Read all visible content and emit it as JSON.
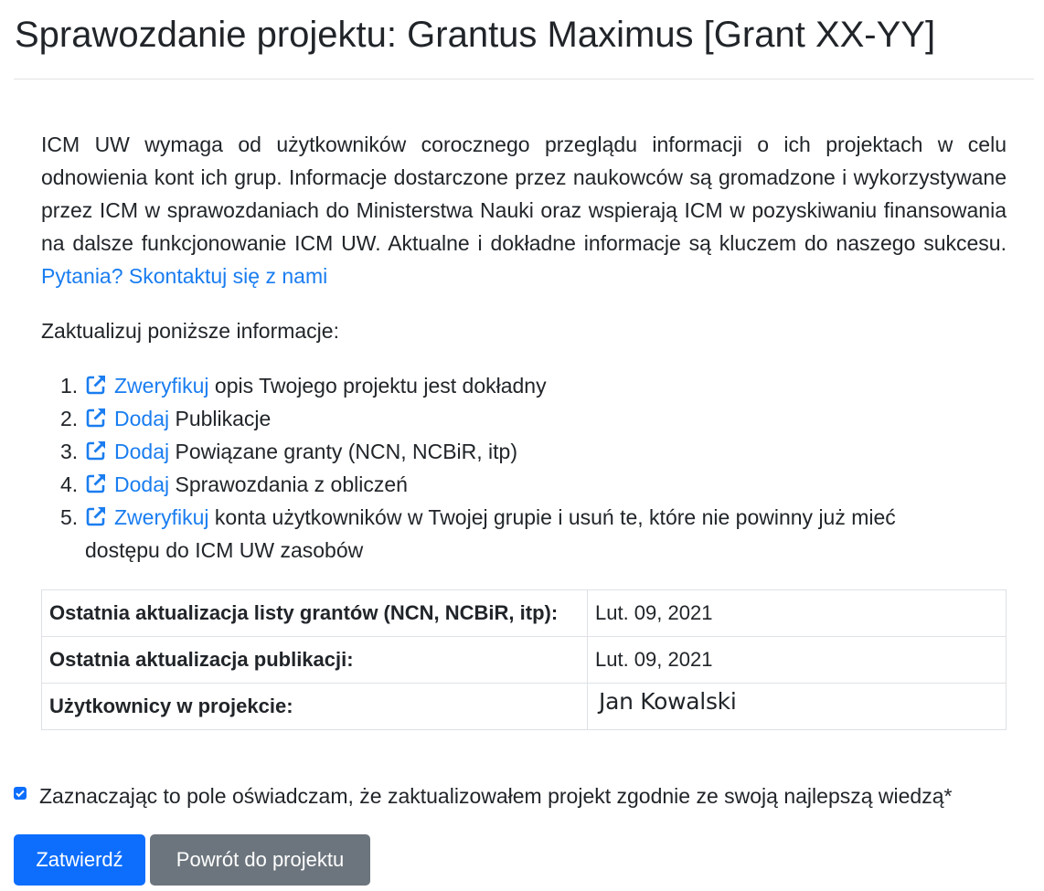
{
  "page": {
    "title": "Sprawozdanie projektu: Grantus Maximus [Grant XX-YY]"
  },
  "intro": {
    "text": "ICM UW wymaga od użytkowników corocznego przeglądu informacji o ich projektach w celu odnowienia kont ich grup. Informacje dostarczone przez naukowców są gromadzone i wykorzystywane przez ICM w sprawozdaniach do Ministerstwa Nauki oraz wspierają ICM w pozyskiwaniu finansowania na dalsze funkcjonowanie ICM UW. Aktualne i dokładne informacje są kluczem do naszego sukcesu.",
    "contact_link": "Pytania? Skontaktuj się z nami"
  },
  "update_heading": "Zaktualizuj poniższe informacje:",
  "steps": [
    {
      "num": "1.",
      "link": "Zweryfikuj",
      "text": "opis Twojego projektu jest dokładny",
      "icon": "external-link-icon"
    },
    {
      "num": "2.",
      "link": "Dodaj",
      "text": "Publikacje",
      "icon": "external-link-icon"
    },
    {
      "num": "3.",
      "link": "Dodaj",
      "text": "Powiązane granty (NCN, NCBiR, itp)",
      "icon": "external-link-icon"
    },
    {
      "num": "4.",
      "link": "Dodaj",
      "text": "Sprawozdania z obliczeń",
      "icon": "external-link-icon"
    },
    {
      "num": "5.",
      "link": "Zweryfikuj",
      "text": "konta użytkowników w Twojej grupie i usuń te, które nie powinny już mieć dostępu do ICM UW zasobów",
      "icon": "external-link-icon"
    }
  ],
  "info_table": [
    {
      "label": "Ostatnia aktualizacja listy grantów (NCN, NCBiR, itp):",
      "value": "Lut. 09, 2021"
    },
    {
      "label": "Ostatnia aktualizacja publikacji:",
      "value": "Lut. 09, 2021"
    },
    {
      "label": "Użytkownicy w projekcie:",
      "value": "Jan Kowalski"
    }
  ],
  "confirm": {
    "checked": true,
    "text": "Zaznaczając to pole oświadczam, że zaktualizowałem projekt zgodnie ze swoją najlepszą wiedzą*"
  },
  "buttons": {
    "submit": "Zatwierdź",
    "back": "Powrót do projektu"
  },
  "colors": {
    "link": "#1a7df0",
    "primary": "#0d6efd",
    "secondary": "#6c757d"
  }
}
